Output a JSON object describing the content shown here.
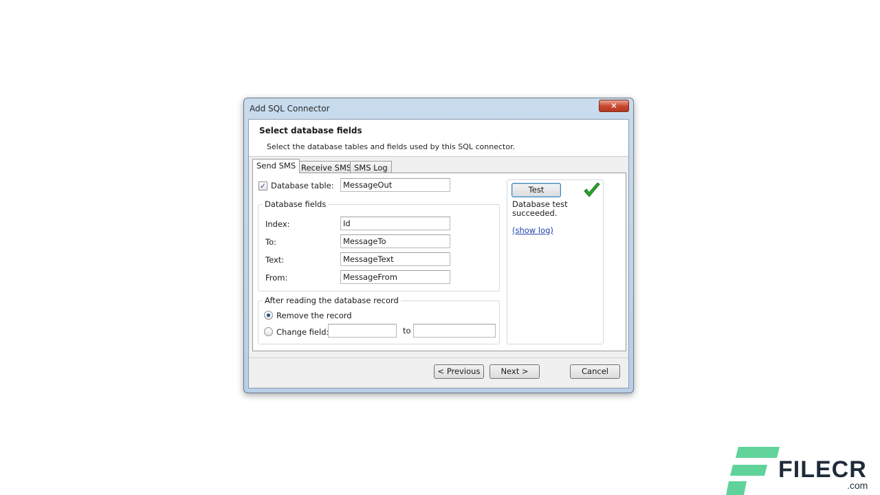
{
  "window": {
    "title": "Add SQL Connector",
    "close_glyph": "✕"
  },
  "header": {
    "title": "Select database fields",
    "subtitle": "Select the database tables and fields used by this SQL connector."
  },
  "tabs": [
    {
      "label": "Send SMS",
      "active": true
    },
    {
      "label": "Receive SMS",
      "active": false
    },
    {
      "label": "SMS Log",
      "active": false
    }
  ],
  "send_sms": {
    "database_table": {
      "label": "Database table:",
      "checked": true,
      "value": "MessageOut"
    },
    "database_fields": {
      "legend": "Database fields",
      "rows": [
        {
          "label": "Index:",
          "value": "Id"
        },
        {
          "label": "To:",
          "value": "MessageTo"
        },
        {
          "label": "Text:",
          "value": "MessageText"
        },
        {
          "label": "From:",
          "value": "MessageFrom"
        }
      ]
    },
    "after_reading": {
      "legend": "After reading the database record",
      "remove_label": "Remove the record",
      "change_label": "Change field:",
      "to_label": "to",
      "selected": "remove",
      "change_field_value": "",
      "change_to_value": ""
    }
  },
  "test_panel": {
    "button_label": "Test",
    "status_text": "Database test succeeded.",
    "show_log_label": "(show log)",
    "status_icon": "checkmark-icon",
    "status_color": "#2aa52a"
  },
  "footer": {
    "previous_label": "< Previous",
    "next_label": "Next >",
    "cancel_label": "Cancel"
  },
  "watermark": {
    "brand": "FILECR",
    "domain": ".com",
    "color": "#5fd39a"
  }
}
